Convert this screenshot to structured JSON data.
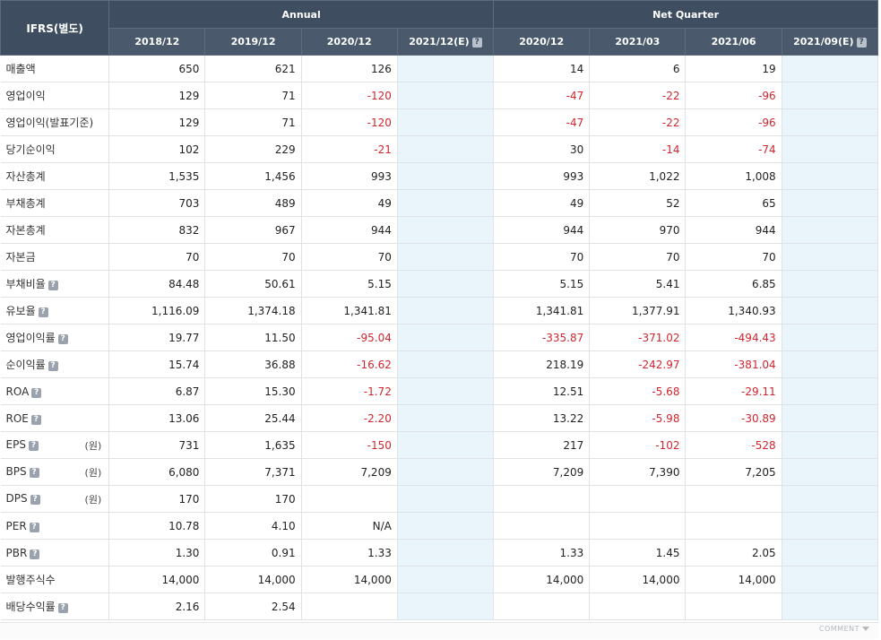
{
  "header": {
    "corner": "IFRS(별도)",
    "annual_label": "Annual",
    "quarter_label": "Net Quarter",
    "annual_periods": [
      "2018/12",
      "2019/12",
      "2020/12",
      "2021/12(E)"
    ],
    "quarter_periods": [
      "2020/12",
      "2021/03",
      "2021/06",
      "2021/09(E)"
    ]
  },
  "rows": [
    {
      "label": "매출액",
      "help": false,
      "unit": "",
      "annual": [
        "650",
        "621",
        "126",
        ""
      ],
      "quarter": [
        "14",
        "6",
        "19",
        ""
      ]
    },
    {
      "label": "영업이익",
      "help": false,
      "unit": "",
      "annual": [
        "129",
        "71",
        "-120",
        ""
      ],
      "quarter": [
        "-47",
        "-22",
        "-96",
        ""
      ]
    },
    {
      "label": "영업이익(발표기준)",
      "help": false,
      "unit": "",
      "annual": [
        "129",
        "71",
        "-120",
        ""
      ],
      "quarter": [
        "-47",
        "-22",
        "-96",
        ""
      ]
    },
    {
      "label": "당기순이익",
      "help": false,
      "unit": "",
      "annual": [
        "102",
        "229",
        "-21",
        ""
      ],
      "quarter": [
        "30",
        "-14",
        "-74",
        ""
      ]
    },
    {
      "label": "자산총계",
      "help": false,
      "unit": "",
      "annual": [
        "1,535",
        "1,456",
        "993",
        ""
      ],
      "quarter": [
        "993",
        "1,022",
        "1,008",
        ""
      ]
    },
    {
      "label": "부채총계",
      "help": false,
      "unit": "",
      "annual": [
        "703",
        "489",
        "49",
        ""
      ],
      "quarter": [
        "49",
        "52",
        "65",
        ""
      ]
    },
    {
      "label": "자본총계",
      "help": false,
      "unit": "",
      "annual": [
        "832",
        "967",
        "944",
        ""
      ],
      "quarter": [
        "944",
        "970",
        "944",
        ""
      ]
    },
    {
      "label": "자본금",
      "help": false,
      "unit": "",
      "annual": [
        "70",
        "70",
        "70",
        ""
      ],
      "quarter": [
        "70",
        "70",
        "70",
        ""
      ]
    },
    {
      "label": "부채비율",
      "help": true,
      "unit": "",
      "annual": [
        "84.48",
        "50.61",
        "5.15",
        ""
      ],
      "quarter": [
        "5.15",
        "5.41",
        "6.85",
        ""
      ]
    },
    {
      "label": "유보율",
      "help": true,
      "unit": "",
      "annual": [
        "1,116.09",
        "1,374.18",
        "1,341.81",
        ""
      ],
      "quarter": [
        "1,341.81",
        "1,377.91",
        "1,340.93",
        ""
      ]
    },
    {
      "label": "영업이익률",
      "help": true,
      "unit": "",
      "annual": [
        "19.77",
        "11.50",
        "-95.04",
        ""
      ],
      "quarter": [
        "-335.87",
        "-371.02",
        "-494.43",
        ""
      ]
    },
    {
      "label": "순이익률",
      "help": true,
      "unit": "",
      "annual": [
        "15.74",
        "36.88",
        "-16.62",
        ""
      ],
      "quarter": [
        "218.19",
        "-242.97",
        "-381.04",
        ""
      ]
    },
    {
      "label": "ROA",
      "help": true,
      "unit": "",
      "annual": [
        "6.87",
        "15.30",
        "-1.72",
        ""
      ],
      "quarter": [
        "12.51",
        "-5.68",
        "-29.11",
        ""
      ]
    },
    {
      "label": "ROE",
      "help": true,
      "unit": "",
      "annual": [
        "13.06",
        "25.44",
        "-2.20",
        ""
      ],
      "quarter": [
        "13.22",
        "-5.98",
        "-30.89",
        ""
      ]
    },
    {
      "label": "EPS",
      "help": true,
      "unit": "(원)",
      "annual": [
        "731",
        "1,635",
        "-150",
        ""
      ],
      "quarter": [
        "217",
        "-102",
        "-528",
        ""
      ]
    },
    {
      "label": "BPS",
      "help": true,
      "unit": "(원)",
      "annual": [
        "6,080",
        "7,371",
        "7,209",
        ""
      ],
      "quarter": [
        "7,209",
        "7,390",
        "7,205",
        ""
      ]
    },
    {
      "label": "DPS",
      "help": true,
      "unit": "(원)",
      "annual": [
        "170",
        "170",
        "",
        ""
      ],
      "quarter": [
        "",
        "",
        "",
        ""
      ]
    },
    {
      "label": "PER",
      "help": true,
      "unit": "",
      "annual": [
        "10.78",
        "4.10",
        "N/A",
        ""
      ],
      "quarter": [
        "",
        "",
        "",
        ""
      ]
    },
    {
      "label": "PBR",
      "help": true,
      "unit": "",
      "annual": [
        "1.30",
        "0.91",
        "1.33",
        ""
      ],
      "quarter": [
        "1.33",
        "1.45",
        "2.05",
        ""
      ]
    },
    {
      "label": "발행주식수",
      "help": false,
      "unit": "",
      "annual": [
        "14,000",
        "14,000",
        "14,000",
        ""
      ],
      "quarter": [
        "14,000",
        "14,000",
        "14,000",
        ""
      ]
    },
    {
      "label": "배당수익률",
      "help": true,
      "unit": "",
      "annual": [
        "2.16",
        "2.54",
        "",
        ""
      ],
      "quarter": [
        "",
        "",
        "",
        ""
      ]
    }
  ],
  "help_glyph": "?",
  "footer": {
    "comment_label": "COMMENT"
  },
  "colors": {
    "header_bg": "#3e4e60",
    "negative": "#d0262f",
    "estimate_bg": "#e9f5fb"
  }
}
